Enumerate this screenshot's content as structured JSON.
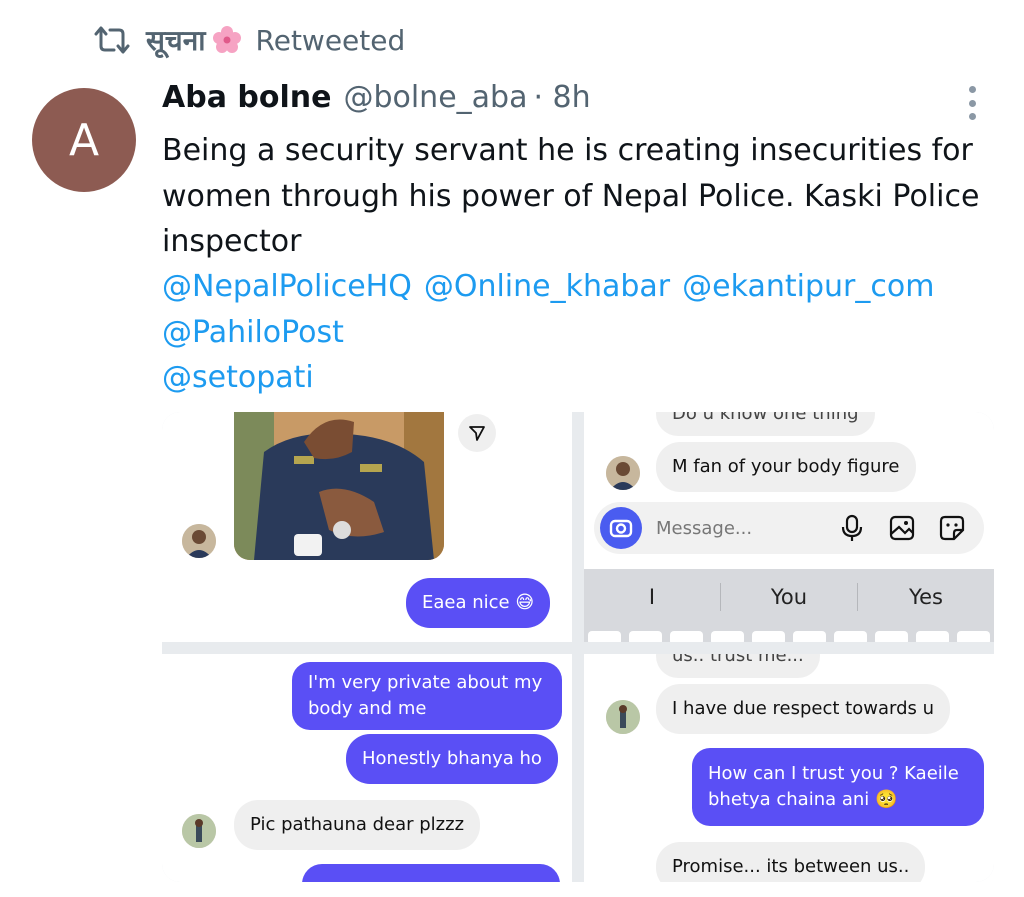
{
  "retweet": {
    "user": "सूचना",
    "label": "Retweeted"
  },
  "tweet": {
    "avatar_letter": "A",
    "display_name": "Aba bolne",
    "handle": "@bolne_aba",
    "time": "· 8h",
    "text": "Being a security servant he is creating insecurities for women through his power of Nepal Police. Kaski Police inspector",
    "mentions": [
      "@NepalPoliceHQ",
      "@Online_khabar",
      "@ekantipur_com",
      "@PahiloPost",
      "@setopati"
    ]
  },
  "screenshots": {
    "p1": {
      "out_msg": "Eaea nice 😅"
    },
    "p2": {
      "in_top_partial": "Do u know one thing",
      "in_msg": "M fan of your body figure",
      "input_placeholder": "Message...",
      "suggestions": [
        "I",
        "You",
        "Yes"
      ]
    },
    "p3": {
      "out_msg_1": "I'm very private about my body and me",
      "out_msg_2": "Honestly bhanya ho",
      "in_msg": "Pic pathauna dear plzzz"
    },
    "p4": {
      "in_top_partial": "us.. trust me...",
      "in_msg_1": "I have due respect towards u",
      "out_msg": "How can I trust you ? Kaeile bhetya chaina ani 🥺",
      "in_msg_2": "Promise... its between us.."
    }
  },
  "colors": {
    "link": "#1d9bf0",
    "secondary": "#536471",
    "outgoing_bubble": "#5a4ff5",
    "avatar_bg": "#8d5b52"
  }
}
